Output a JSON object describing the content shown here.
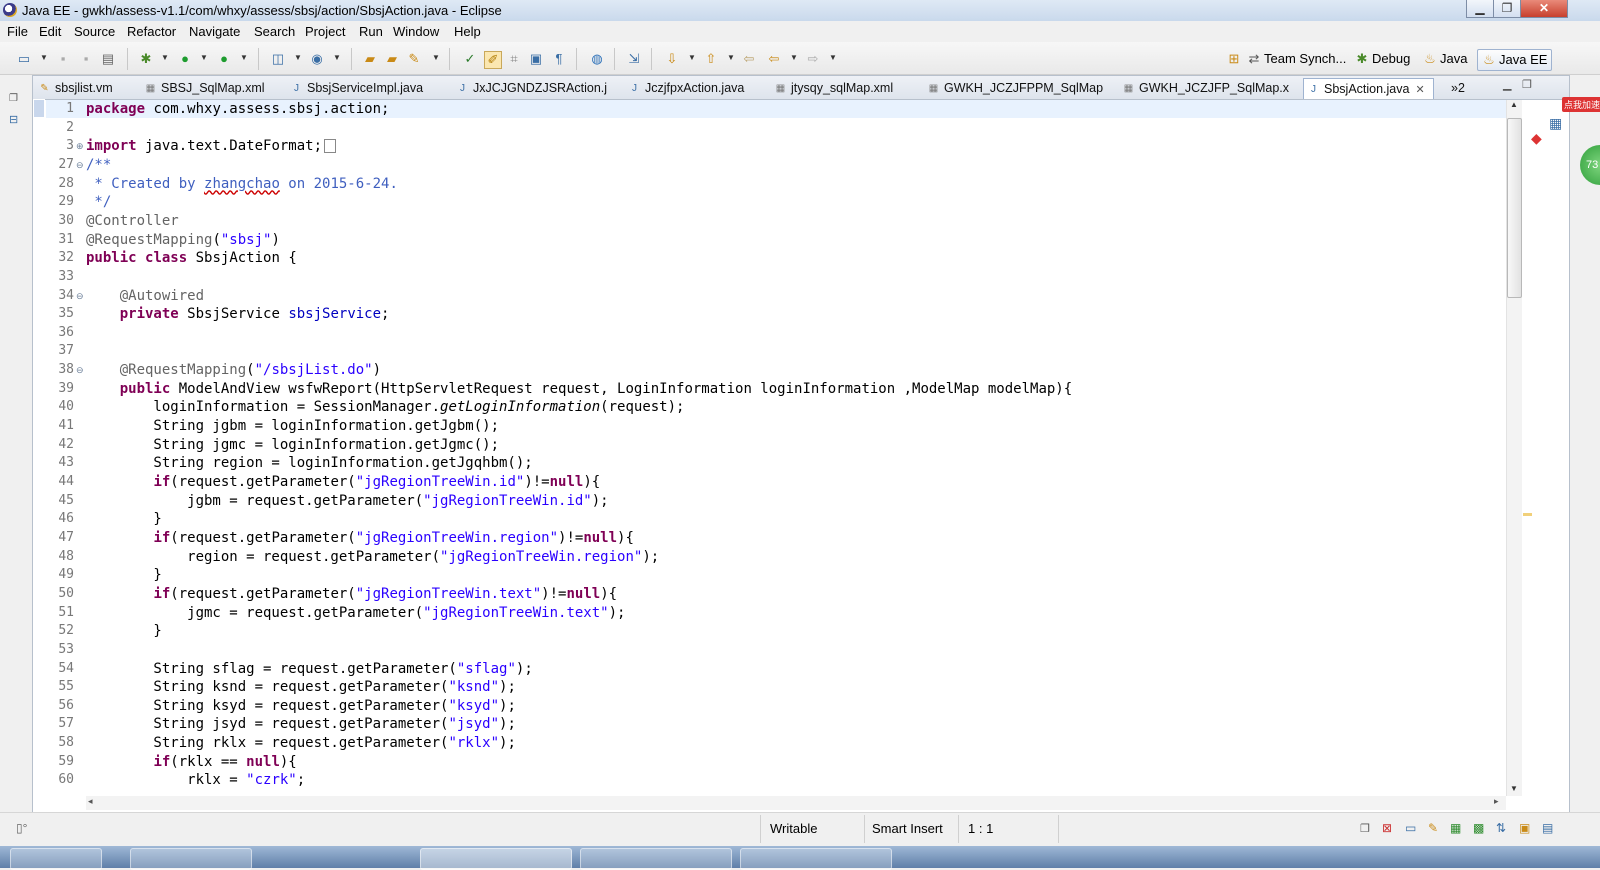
{
  "window": {
    "title": "Java EE - gwkh/assess-v1.1/com/whxy/assess/sbsj/action/SbsjAction.java - Eclipse",
    "minimize_glyph": "▁",
    "maximize_glyph": "❐",
    "close_glyph": "✕"
  },
  "menu": [
    "File",
    "Edit",
    "Source",
    "Refactor",
    "Navigate",
    "Search",
    "Project",
    "Run",
    "Window",
    "Help"
  ],
  "perspectives": {
    "team_sync": "Team Synch...",
    "debug": "Debug",
    "java": "Java",
    "java_ee": "Java EE"
  },
  "tabs": [
    {
      "label": "sbsjlist.vm",
      "icon": "velocity-file-icon"
    },
    {
      "label": "SBSJ_SqlMap.xml",
      "icon": "xml-file-icon"
    },
    {
      "label": "SbsjServiceImpl.java",
      "icon": "java-file-icon"
    },
    {
      "label": "JxJCJGNDZJSRAction.j",
      "icon": "java-file-icon"
    },
    {
      "label": "JczjfpxAction.java",
      "icon": "java-file-icon"
    },
    {
      "label": "jtysqy_sqlMap.xml",
      "icon": "xml-file-icon"
    },
    {
      "label": "GWKH_JCZJFPPM_SqlMap",
      "icon": "xml-file-icon"
    },
    {
      "label": "GWKH_JCZJFP_SqlMap.x",
      "icon": "xml-file-icon"
    },
    {
      "label": "SbsjAction.java",
      "icon": "java-file-icon",
      "active": true
    }
  ],
  "tab_overflow": "»2",
  "editor": {
    "lines": [
      {
        "n": "1",
        "fold": "",
        "code": [
          [
            "kw",
            "package"
          ],
          [
            "t",
            " com.whxy.assess.sbsj.action;"
          ]
        ]
      },
      {
        "n": "2",
        "fold": "",
        "code": []
      },
      {
        "n": "3",
        "fold": "⊕",
        "code": [
          [
            "kw",
            "import"
          ],
          [
            "t",
            " java.text.DateFormat;"
          ],
          [
            "box",
            ""
          ]
        ]
      },
      {
        "n": "27",
        "fold": "⊖",
        "code": [
          [
            "doc",
            "/**"
          ]
        ]
      },
      {
        "n": "28",
        "fold": "",
        "code": [
          [
            "doc",
            " * Created by "
          ],
          [
            "docsq",
            "zhangchao"
          ],
          [
            "doc",
            " on 2015-6-24."
          ]
        ]
      },
      {
        "n": "29",
        "fold": "",
        "code": [
          [
            "doc",
            " */"
          ]
        ]
      },
      {
        "n": "30",
        "fold": "",
        "code": [
          [
            "ann",
            "@Controller"
          ]
        ]
      },
      {
        "n": "31",
        "fold": "",
        "code": [
          [
            "ann",
            "@RequestMapping"
          ],
          [
            "t",
            "("
          ],
          [
            "str",
            "\"sbsj\""
          ],
          [
            "t",
            ")"
          ]
        ]
      },
      {
        "n": "32",
        "fold": "",
        "code": [
          [
            "kw",
            "public"
          ],
          [
            "t",
            " "
          ],
          [
            "kw",
            "class"
          ],
          [
            "t",
            " SbsjAction {"
          ]
        ]
      },
      {
        "n": "33",
        "fold": "",
        "code": []
      },
      {
        "n": "34",
        "fold": "⊖",
        "code": [
          [
            "t",
            "    "
          ],
          [
            "ann",
            "@Autowired"
          ]
        ]
      },
      {
        "n": "35",
        "fold": "",
        "code": [
          [
            "t",
            "    "
          ],
          [
            "kw",
            "private"
          ],
          [
            "t",
            " SbsjService "
          ],
          [
            "fld",
            "sbsjService"
          ],
          [
            "t",
            ";"
          ]
        ]
      },
      {
        "n": "36",
        "fold": "",
        "code": []
      },
      {
        "n": "37",
        "fold": "",
        "code": []
      },
      {
        "n": "38",
        "fold": "⊖",
        "code": [
          [
            "t",
            "    "
          ],
          [
            "ann",
            "@RequestMapping"
          ],
          [
            "t",
            "("
          ],
          [
            "str",
            "\"/sbsjList.do\""
          ],
          [
            "t",
            ")"
          ]
        ]
      },
      {
        "n": "39",
        "fold": "",
        "code": [
          [
            "t",
            "    "
          ],
          [
            "kw",
            "public"
          ],
          [
            "t",
            " ModelAndView wsfwReport(HttpServletRequest request, LoginInformation loginInformation ,ModelMap modelMap){"
          ]
        ]
      },
      {
        "n": "40",
        "fold": "",
        "code": [
          [
            "t",
            "        loginInformation = SessionManager."
          ],
          [
            "ital",
            "getLoginInformation"
          ],
          [
            "t",
            "(request);"
          ]
        ]
      },
      {
        "n": "41",
        "fold": "",
        "code": [
          [
            "t",
            "        String jgbm = loginInformation.getJgbm();"
          ]
        ]
      },
      {
        "n": "42",
        "fold": "",
        "code": [
          [
            "t",
            "        String jgmc = loginInformation.getJgmc();"
          ]
        ]
      },
      {
        "n": "43",
        "fold": "",
        "code": [
          [
            "t",
            "        String region = loginInformation.getJgqhbm();"
          ]
        ]
      },
      {
        "n": "44",
        "fold": "",
        "code": [
          [
            "t",
            "        "
          ],
          [
            "kw",
            "if"
          ],
          [
            "t",
            "(request.getParameter("
          ],
          [
            "str",
            "\"jgRegionTreeWin.id\""
          ],
          [
            "t",
            ")!="
          ],
          [
            "kw",
            "null"
          ],
          [
            "t",
            "){"
          ]
        ]
      },
      {
        "n": "45",
        "fold": "",
        "code": [
          [
            "t",
            "            jgbm = request.getParameter("
          ],
          [
            "str",
            "\"jgRegionTreeWin.id\""
          ],
          [
            "t",
            ");"
          ]
        ]
      },
      {
        "n": "46",
        "fold": "",
        "code": [
          [
            "t",
            "        }"
          ]
        ]
      },
      {
        "n": "47",
        "fold": "",
        "code": [
          [
            "t",
            "        "
          ],
          [
            "kw",
            "if"
          ],
          [
            "t",
            "(request.getParameter("
          ],
          [
            "str",
            "\"jgRegionTreeWin.region\""
          ],
          [
            "t",
            ")!="
          ],
          [
            "kw",
            "null"
          ],
          [
            "t",
            "){"
          ]
        ]
      },
      {
        "n": "48",
        "fold": "",
        "code": [
          [
            "t",
            "            region = request.getParameter("
          ],
          [
            "str",
            "\"jgRegionTreeWin.region\""
          ],
          [
            "t",
            ");"
          ]
        ]
      },
      {
        "n": "49",
        "fold": "",
        "code": [
          [
            "t",
            "        }"
          ]
        ]
      },
      {
        "n": "50",
        "fold": "",
        "code": [
          [
            "t",
            "        "
          ],
          [
            "kw",
            "if"
          ],
          [
            "t",
            "(request.getParameter("
          ],
          [
            "str",
            "\"jgRegionTreeWin.text\""
          ],
          [
            "t",
            ")!="
          ],
          [
            "kw",
            "null"
          ],
          [
            "t",
            "){"
          ]
        ]
      },
      {
        "n": "51",
        "fold": "",
        "code": [
          [
            "t",
            "            jgmc = request.getParameter("
          ],
          [
            "str",
            "\"jgRegionTreeWin.text\""
          ],
          [
            "t",
            ");"
          ]
        ]
      },
      {
        "n": "52",
        "fold": "",
        "code": [
          [
            "t",
            "        }"
          ]
        ]
      },
      {
        "n": "53",
        "fold": "",
        "code": []
      },
      {
        "n": "54",
        "fold": "",
        "code": [
          [
            "t",
            "        String sflag = request.getParameter("
          ],
          [
            "str",
            "\"sflag\""
          ],
          [
            "t",
            ");"
          ]
        ]
      },
      {
        "n": "55",
        "fold": "",
        "code": [
          [
            "t",
            "        String ksnd = request.getParameter("
          ],
          [
            "str",
            "\"ksnd\""
          ],
          [
            "t",
            ");"
          ]
        ]
      },
      {
        "n": "56",
        "fold": "",
        "code": [
          [
            "t",
            "        String ksyd = request.getParameter("
          ],
          [
            "str",
            "\"ksyd\""
          ],
          [
            "t",
            ");"
          ]
        ]
      },
      {
        "n": "57",
        "fold": "",
        "code": [
          [
            "t",
            "        String jsyd = request.getParameter("
          ],
          [
            "str",
            "\"jsyd\""
          ],
          [
            "t",
            ");"
          ]
        ]
      },
      {
        "n": "58",
        "fold": "",
        "code": [
          [
            "t",
            "        String rklx = request.getParameter("
          ],
          [
            "str",
            "\"rklx\""
          ],
          [
            "t",
            ");"
          ]
        ]
      },
      {
        "n": "59",
        "fold": "",
        "code": [
          [
            "t",
            "        "
          ],
          [
            "kw",
            "if"
          ],
          [
            "t",
            "(rklx == "
          ],
          [
            "kw",
            "null"
          ],
          [
            "t",
            "){"
          ]
        ]
      },
      {
        "n": "60",
        "fold": "",
        "code": [
          [
            "t",
            "            rklx = "
          ],
          [
            "str",
            "\"czrk\""
          ],
          [
            "t",
            ";"
          ]
        ]
      }
    ]
  },
  "status": {
    "writable": "Writable",
    "insert_mode": "Smart Insert",
    "position": "1 : 1"
  },
  "side_widget": {
    "label": "点我加速",
    "badge": "73"
  },
  "colors": {
    "keyword": "#7f0055",
    "string": "#2a00ff",
    "field": "#0000c0",
    "annotation": "#646464",
    "javadoc": "#3f5fbf"
  }
}
